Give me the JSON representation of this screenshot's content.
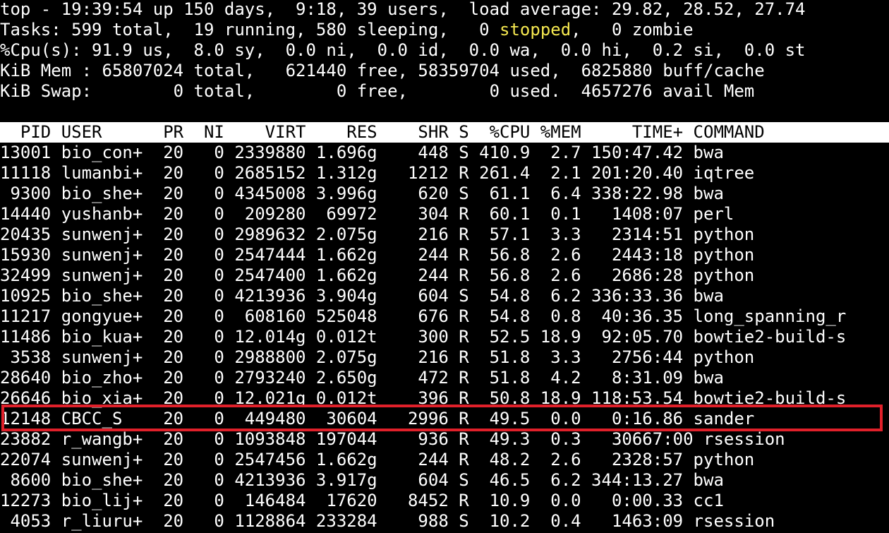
{
  "summary": {
    "line1": "top - 19:39:54 up 150 days,  9:18, 39 users,  load average: 29.82, 28.52, 27.74",
    "tasks_prefix": "Tasks: 599 total,  19 running, 580 sleeping,   0 ",
    "tasks_stopped": "stopped",
    "tasks_suffix": ",   0 zombie",
    "cpu": "%Cpu(s): 91.9 us,  8.0 sy,  0.0 ni,  0.0 id,  0.0 wa,  0.0 hi,  0.2 si,  0.0 st",
    "mem": "KiB Mem : 65807024 total,   621440 free, 58359704 used,  6825880 buff/cache",
    "swap": "KiB Swap:        0 total,        0 free,        0 used.  4657276 avail Mem"
  },
  "table": {
    "header": "  PID USER      PR  NI    VIRT    RES    SHR S  %CPU %MEM     TIME+ COMMAND",
    "rows": [
      "13001 bio_con+  20   0 2339880 1.696g    448 S 410.9  2.7 150:47.42 bwa",
      "11118 lumanbi+  20   0 2685152 1.312g   1212 R 261.4  2.1 201:20.40 iqtree",
      " 9300 bio_she+  20   0 4345008 3.996g    620 S  61.1  6.4 338:22.98 bwa",
      "14440 yushanb+  20   0  209280  69972    304 R  60.1  0.1   1408:07 perl",
      "20435 sunwenj+  20   0 2989632 2.075g    216 R  57.1  3.3   2314:51 python",
      "15930 sunwenj+  20   0 2547444 1.662g    244 R  56.8  2.6   2443:18 python",
      "32499 sunwenj+  20   0 2547400 1.662g    244 R  56.8  2.6   2686:28 python",
      "10925 bio_she+  20   0 4213936 3.904g    604 S  54.8  6.2 336:33.36 bwa",
      "11217 gongyue+  20   0  608160 525048    676 R  54.8  0.8  40:36.35 long_spanning_r",
      "11486 bio_kua+  20   0 12.014g 0.012t    300 R  52.5 18.9  92:05.70 bowtie2-build-s",
      " 3538 sunwenj+  20   0 2988800 2.075g    216 R  51.8  3.3   2756:44 python",
      "28640 bio_zho+  20   0 2793240 2.650g    472 R  51.8  4.2   8:31.09 bwa",
      "26646 bio_xia+  20   0 12.021g 0.012t    396 R  50.8 18.9 118:53.54 bowtie2-build-s",
      "12148 CBCC_S    20   0  449480  30604   2996 R  49.5  0.0   0:16.86 sander",
      "23882 r_wangb+  20   0 1093848 197044    936 R  49.3  0.3   30667:00 rsession",
      "22074 sunwenj+  20   0 2547456 1.662g    244 R  48.2  2.6   2328:57 python",
      " 8600 bio_she+  20   0 4213936 3.917g    604 S  46.5  6.2 344:13.27 bwa",
      "12273 bio_lij+  20   0  146484  17620   8452 R  10.9  0.0   0:00.33 cc1",
      " 4053 r_liuru+  20   0 1128864 233284    988 S  10.2  0.4   1463:09 rsession"
    ]
  },
  "colors": {
    "background": "#000000",
    "foreground": "#ffffff",
    "stopped": "#f5e850",
    "highlight_border": "#e0202a"
  }
}
